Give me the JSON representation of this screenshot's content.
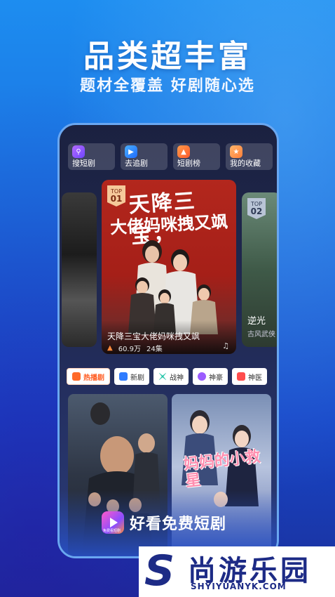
{
  "hero": {
    "title": "品类超丰富",
    "subtitle": "题材全覆盖  好剧随心选"
  },
  "quick_actions": [
    {
      "label": "搜短剧",
      "icon": "search-icon"
    },
    {
      "label": "去追剧",
      "icon": "play-icon"
    },
    {
      "label": "短剧榜",
      "icon": "rank-icon"
    },
    {
      "label": "我的收藏",
      "icon": "star-icon"
    }
  ],
  "featured": {
    "badge_top": "TOP",
    "badge_rank": "01",
    "poster_line1": "天降三宝，",
    "poster_line2": "大佬妈咪拽又飒",
    "title": "天降三宝大佬妈咪拽又飒",
    "views": "60.9万",
    "episodes": "24集"
  },
  "second": {
    "badge_top": "TOP",
    "badge_rank": "02",
    "title": "逆光",
    "genre": "古风武侠"
  },
  "categories": [
    {
      "label": "热播剧",
      "active": true
    },
    {
      "label": "新剧",
      "active": false
    },
    {
      "label": "战神",
      "active": false
    },
    {
      "label": "神豪",
      "active": false
    },
    {
      "label": "神医",
      "active": false
    }
  ],
  "grid": {
    "right_poster_title": "妈妈的小救星"
  },
  "app": {
    "name": "好看免费短剧",
    "logo_caption": "免费看短剧"
  },
  "watermark": {
    "logo": "S",
    "title": "尚游乐园",
    "url": "SHYIYUANYK.COM"
  },
  "colors": {
    "brand_blue": "#1a6fe0",
    "hot_orange": "#ff5a1f",
    "watermark_navy": "#1d2b86"
  }
}
